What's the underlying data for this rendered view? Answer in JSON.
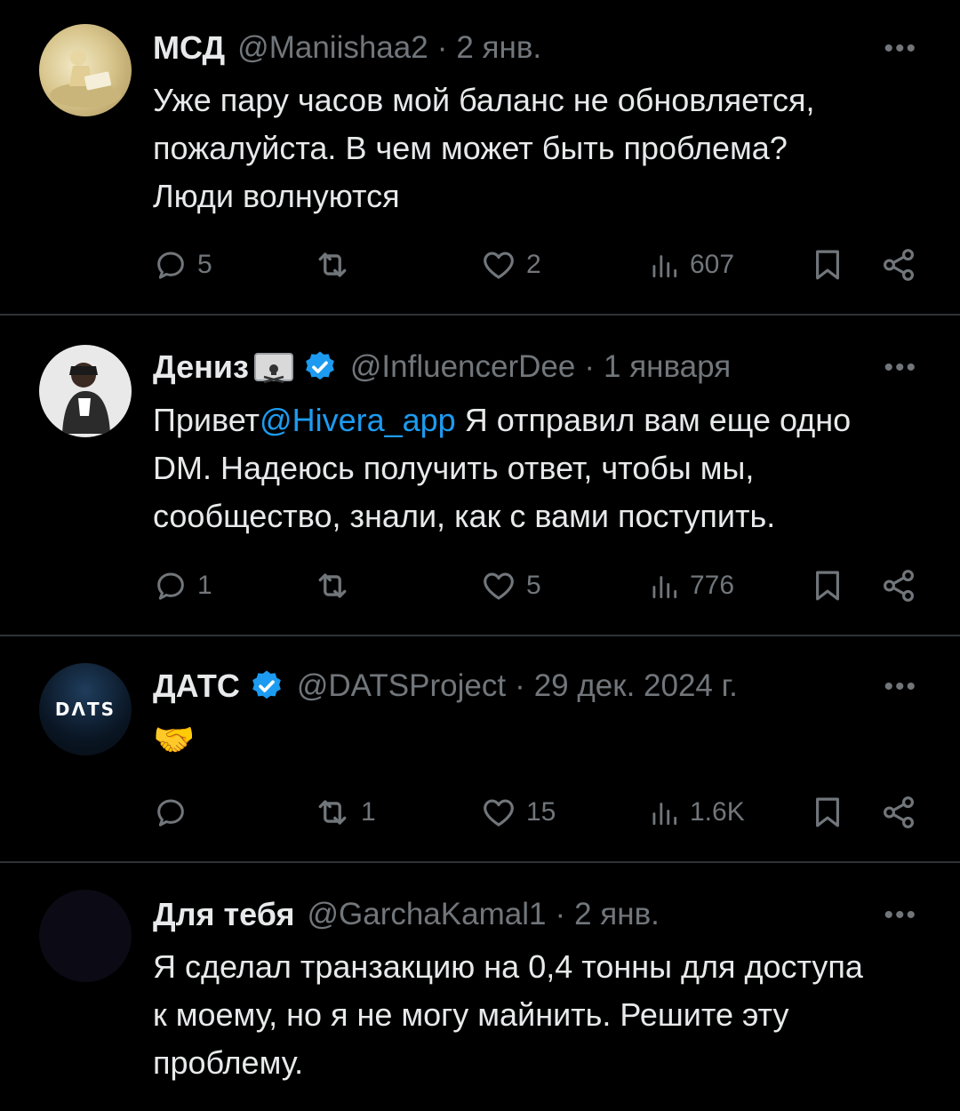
{
  "tweets": [
    {
      "name": "МСД",
      "handle": "@Maniishaa2",
      "time": "2 янв.",
      "text_lines": [
        "Уже пару часов мой баланс не обновляется,",
        "пожалуйста. В чем может быть проблема?",
        "Люди волнуются"
      ],
      "replies": "5",
      "retweets": "",
      "likes": "2",
      "views": "607",
      "avatar": "figure-reading-avatar"
    },
    {
      "name": "Дениз",
      "handle": "@InfluencerDee",
      "time": "1 января",
      "text_pre": "Привет",
      "mention": "@Hivera_app",
      "text_line1_rest": " Я отправил вам еще одно",
      "text_lines_rest": [
        "DM. Надеюсь получить ответ, чтобы мы,",
        "сообщество, знали, как с вами поступить."
      ],
      "replies": "1",
      "retweets": "",
      "likes": "5",
      "views": "776",
      "avatar": "person-avatar"
    },
    {
      "name": "ДАТС",
      "handle": "@DATSProject",
      "time": "29 дек. 2024 г.",
      "text": "🤝",
      "replies": "",
      "retweets": "1",
      "likes": "15",
      "views": "1.6K",
      "avatar_text": "DΛTS"
    },
    {
      "name": "Для тебя",
      "handle": "@GarchaKamal1",
      "time": "2 янв.",
      "text_lines": [
        "Я сделал транзакцию на 0,4 тонны для доступа",
        "к моему, но я не могу майнить. Решите эту",
        "проблему."
      ]
    }
  ],
  "more_label": "•••",
  "colors": {
    "accent": "#1d9bf0",
    "muted": "#71767b",
    "text": "#e7e9ea",
    "divider": "#2f3336"
  },
  "icons": [
    "reply-icon",
    "retweet-icon",
    "like-icon",
    "views-icon",
    "bookmark-icon",
    "share-icon",
    "verified-icon",
    "more-icon"
  ]
}
